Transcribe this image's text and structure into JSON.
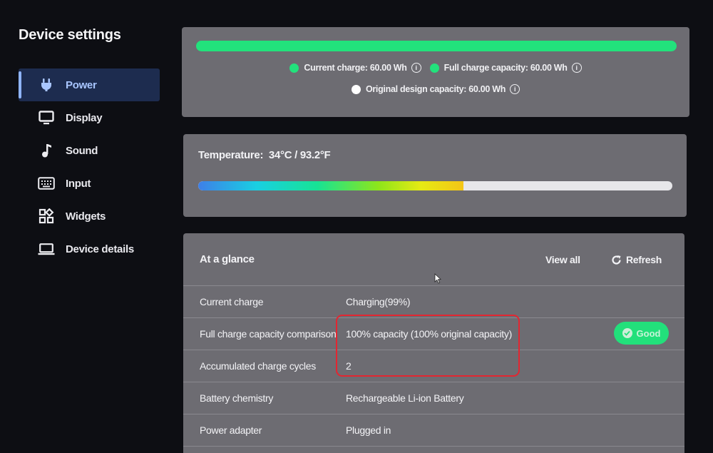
{
  "app": {
    "title": "Device settings"
  },
  "sidebar": {
    "items": [
      {
        "label": "Power",
        "icon": "power-plug-icon",
        "active": true
      },
      {
        "label": "Display",
        "icon": "monitor-icon"
      },
      {
        "label": "Sound",
        "icon": "music-note-icon"
      },
      {
        "label": "Input",
        "icon": "keyboard-icon"
      },
      {
        "label": "Widgets",
        "icon": "widgets-grid-icon"
      },
      {
        "label": "Device details",
        "icon": "laptop-icon"
      }
    ]
  },
  "charge": {
    "bar_fill_percent": 100,
    "legend": {
      "current": {
        "label": "Current charge: 60.00 Wh",
        "color": "#22e27c"
      },
      "full": {
        "label": "Full charge capacity: 60.00 Wh",
        "color": "#22e27c"
      },
      "design": {
        "label": "Original design capacity: 60.00 Wh",
        "color": "#ffffff"
      }
    }
  },
  "temperature": {
    "label": "Temperature:",
    "value": "34°C / 93.2°F",
    "bar_fill_fraction": 0.56
  },
  "glance": {
    "title": "At a glance",
    "view_all": "View all",
    "refresh": "Refresh",
    "rows": [
      {
        "key": "Current charge",
        "value": "Charging(99%)"
      },
      {
        "key": "Full charge capacity comparison",
        "value": "100% capacity (100% original capacity)",
        "badge": "Good"
      },
      {
        "key": "Accumulated charge cycles",
        "value": "2"
      },
      {
        "key": "Battery chemistry",
        "value": "Rechargeable Li-ion Battery"
      },
      {
        "key": "Power adapter",
        "value": "Plugged in"
      }
    ]
  },
  "colors": {
    "accent_green": "#22e27c",
    "nav_active_bg": "#1d2c4f",
    "highlight_red": "#e32631"
  }
}
